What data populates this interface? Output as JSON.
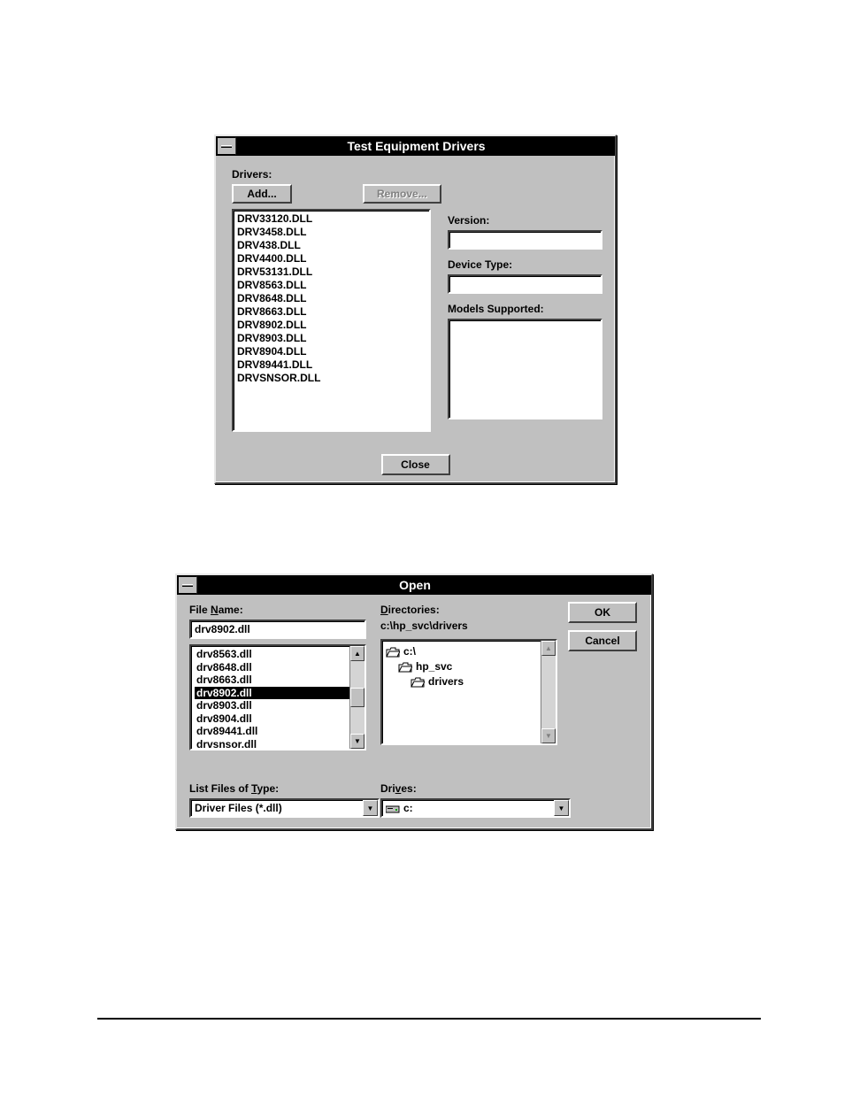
{
  "dialog1": {
    "title": "Test Equipment Drivers",
    "drivers_label": "Drivers:",
    "add_label": "Add...",
    "remove_label": "Remove...",
    "version_label": "Version:",
    "device_type_label": "Device Type:",
    "models_supported_label": "Models Supported:",
    "close_label": "Close",
    "drivers": [
      "DRV33120.DLL",
      "DRV3458.DLL",
      "DRV438.DLL",
      "DRV4400.DLL",
      "DRV53131.DLL",
      "DRV8563.DLL",
      "DRV8648.DLL",
      "DRV8663.DLL",
      "DRV8902.DLL",
      "DRV8903.DLL",
      "DRV8904.DLL",
      "DRV89441.DLL",
      "DRVSNSOR.DLL"
    ]
  },
  "dialog2": {
    "title": "Open",
    "file_name_label_pre": "File ",
    "file_name_label_hot": "N",
    "file_name_label_post": "ame:",
    "file_name_value": "drv8902.dll",
    "files": [
      {
        "name": "drv8563.dll",
        "selected": false
      },
      {
        "name": "drv8648.dll",
        "selected": false
      },
      {
        "name": "drv8663.dll",
        "selected": false
      },
      {
        "name": "drv8902.dll",
        "selected": true
      },
      {
        "name": "drv8903.dll",
        "selected": false
      },
      {
        "name": "drv8904.dll",
        "selected": false
      },
      {
        "name": "drv89441.dll",
        "selected": false
      },
      {
        "name": "drvsnsor.dll",
        "selected": false
      }
    ],
    "list_type_label_pre": "List Files of ",
    "list_type_label_hot": "T",
    "list_type_label_post": "ype:",
    "list_type_value": "Driver Files (*.dll)",
    "directories_label_hot": "D",
    "directories_label_post": "irectories:",
    "directories_path": "c:\\hp_svc\\drivers",
    "dir_tree": [
      {
        "level": 1,
        "name": "c:\\",
        "open": true
      },
      {
        "level": 2,
        "name": "hp_svc",
        "open": true
      },
      {
        "level": 3,
        "name": "drivers",
        "open": true
      }
    ],
    "drives_label_pre": "Dri",
    "drives_label_hot": "v",
    "drives_label_post": "es:",
    "drives_value": "c:",
    "ok_label": "OK",
    "cancel_label": "Cancel"
  }
}
